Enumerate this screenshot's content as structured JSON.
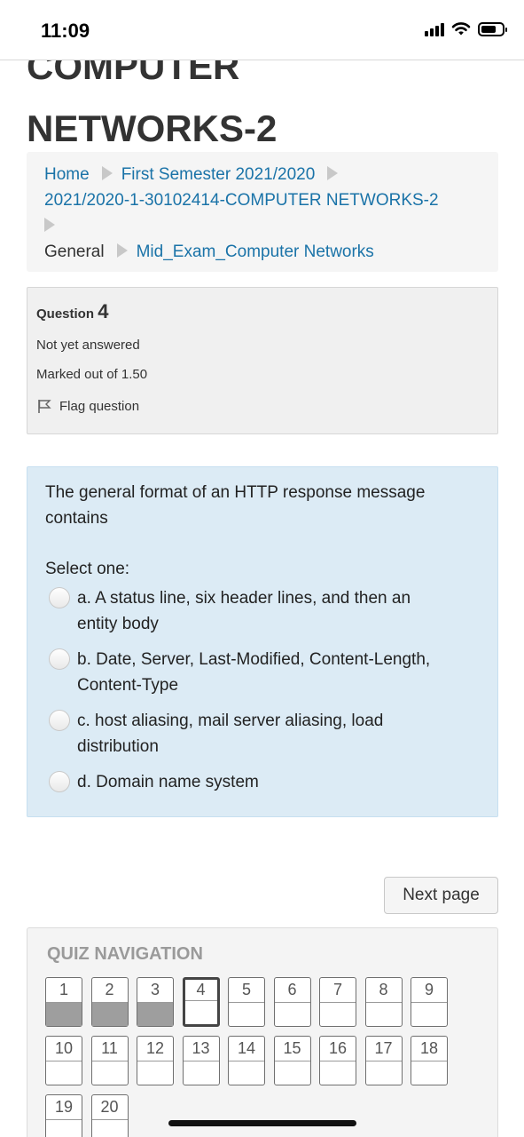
{
  "status_bar": {
    "time": "11:09"
  },
  "course": {
    "title_line1": "COMPUTER",
    "title_line2": "NETWORKS-2"
  },
  "breadcrumb": {
    "home": "Home",
    "semester": "First Semester 2021/2020",
    "course": "2021/2020-1-30102414-COMPUTER NETWORKS-2",
    "section": "General",
    "quiz": "Mid_Exam_Computer Networks"
  },
  "question_info": {
    "label": "Question",
    "number": "4",
    "status": "Not yet answered",
    "marks": "Marked out of 1.50",
    "flag_label": "Flag question"
  },
  "question": {
    "text": "The general format of an HTTP response message contains",
    "prompt": "Select one:",
    "options": [
      "a. A status line, six header lines, and then an entity body",
      "b. Date, Server, Last-Modified, Content-Length, Content-Type",
      "c. host aliasing, mail server aliasing, load distribution",
      "d. Domain name system"
    ]
  },
  "actions": {
    "next_label": "Next page"
  },
  "quiz_navigation": {
    "title": "QUIZ NAVIGATION",
    "current": 4,
    "answered": [
      1,
      2,
      3
    ],
    "questions": [
      "1",
      "2",
      "3",
      "4",
      "5",
      "6",
      "7",
      "8",
      "9",
      "10",
      "11",
      "12",
      "13",
      "14",
      "15",
      "16",
      "17",
      "18",
      "19",
      "20"
    ]
  }
}
